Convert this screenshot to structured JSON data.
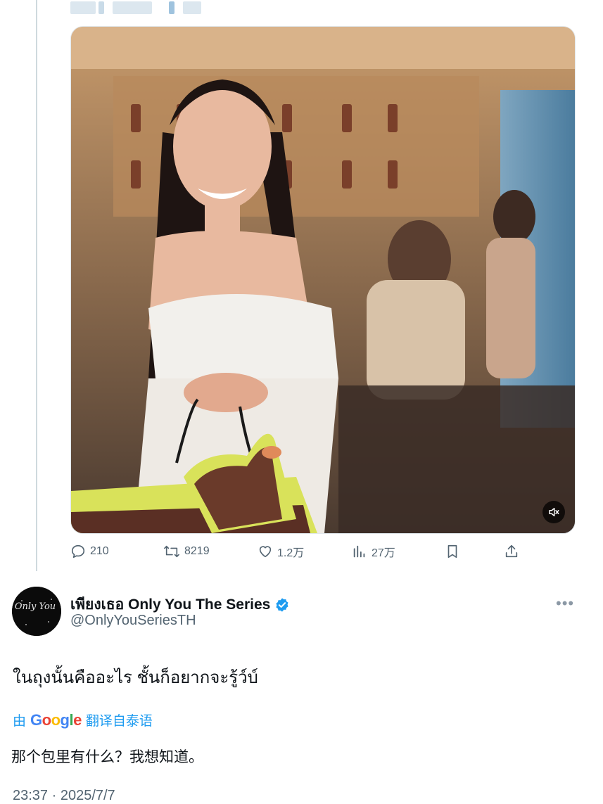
{
  "quoted_media": {
    "mute_icon": "volume-muted-icon"
  },
  "actions": {
    "reply_count": "210",
    "retweet_count": "8219",
    "like_count": "1.2万",
    "view_count": "27万"
  },
  "author": {
    "display_name": "เพียงเธอ Only You The Series",
    "handle": "@OnlyYouSeriesTH",
    "verified": true,
    "avatar_text": "Only You"
  },
  "tweet": {
    "text": "ในถุงนั้นคืออะไร ชั้นก็อยากจะรู้ว์บ์",
    "translation_prefix": "由",
    "translation_brand": "Google",
    "translation_suffix": "翻译自泰语",
    "translated_text": "那个包里有什么？我想知道。",
    "timestamp": "23:37 · 2025/7/7"
  },
  "colors": {
    "link": "#1d9bf0",
    "muted": "#536471",
    "verified": "#1d9bf0"
  }
}
